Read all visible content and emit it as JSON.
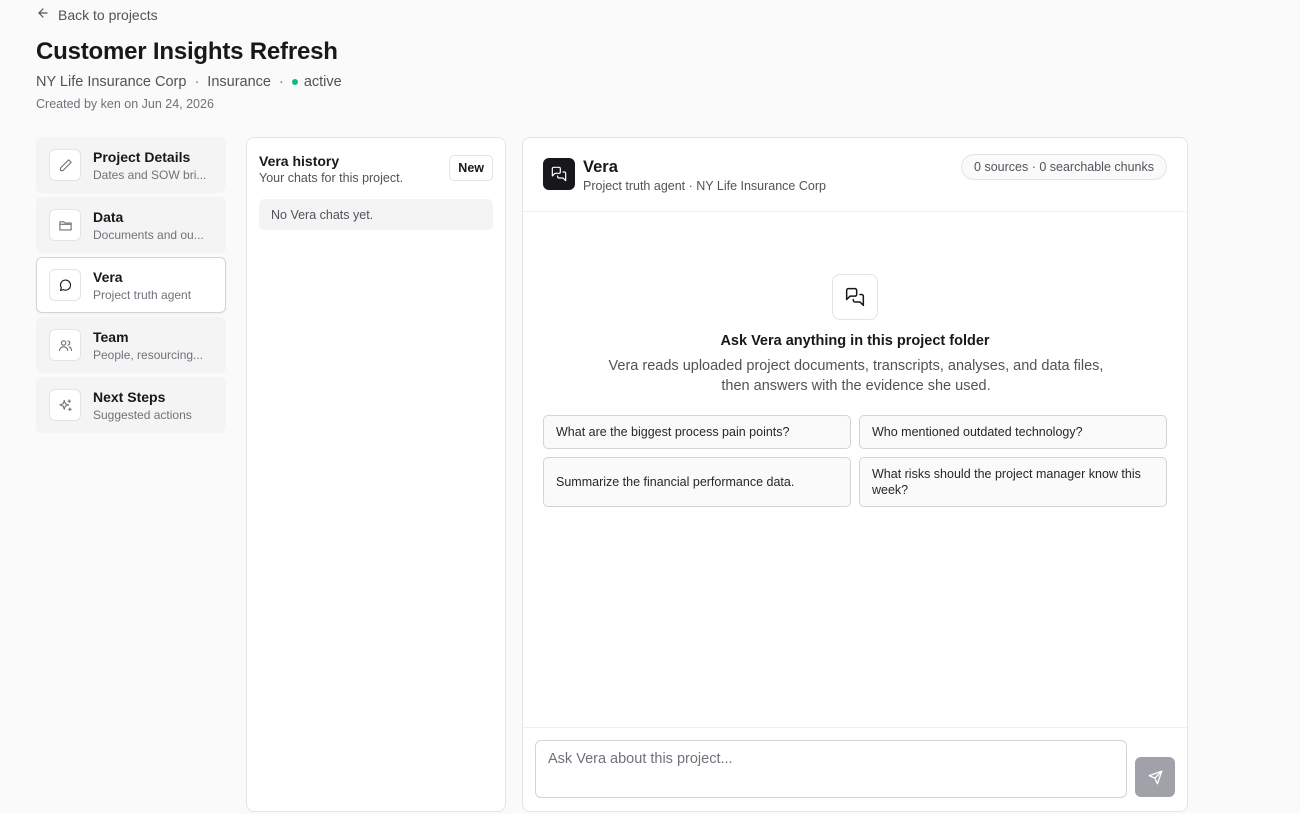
{
  "header": {
    "back_label": "Back to projects",
    "title": "Customer Insights Refresh",
    "client": "NY Life Insurance Corp",
    "industry": "Insurance",
    "separator": "·",
    "status": "active",
    "status_color": "#10b981",
    "created": "Created by ken on Jun 24, 2026"
  },
  "nav": {
    "items": [
      {
        "title": "Project Details",
        "subtitle": "Dates and SOW bri...",
        "icon": "pencil-icon"
      },
      {
        "title": "Data",
        "subtitle": "Documents and ou...",
        "icon": "folder-icon"
      },
      {
        "title": "Vera",
        "subtitle": "Project truth agent",
        "icon": "chat-bubble-icon",
        "active": true
      },
      {
        "title": "Team",
        "subtitle": "People, resourcing...",
        "icon": "users-icon"
      },
      {
        "title": "Next Steps",
        "subtitle": "Suggested actions",
        "icon": "sparkles-icon"
      }
    ]
  },
  "history": {
    "title": "Vera history",
    "subtitle": "Your chats for this project.",
    "new_label": "New",
    "empty_text": "No Vera chats yet."
  },
  "chat": {
    "agent_name": "Vera",
    "agent_subtitle": "Project truth agent · NY Life Insurance Corp",
    "sources": "0 sources · 0 searchable chunks",
    "empty_title": "Ask Vera anything in this project folder",
    "empty_desc": "Vera reads uploaded project documents, transcripts, analyses, and data files, then answers with the evidence she used.",
    "suggestions": [
      "What are the biggest process pain points?",
      "Who mentioned outdated technology?",
      "Summarize the financial performance data.",
      "What risks should the project manager know this week?"
    ],
    "input_placeholder": "Ask Vera about this project...",
    "send_color": "#a1a1aa"
  }
}
